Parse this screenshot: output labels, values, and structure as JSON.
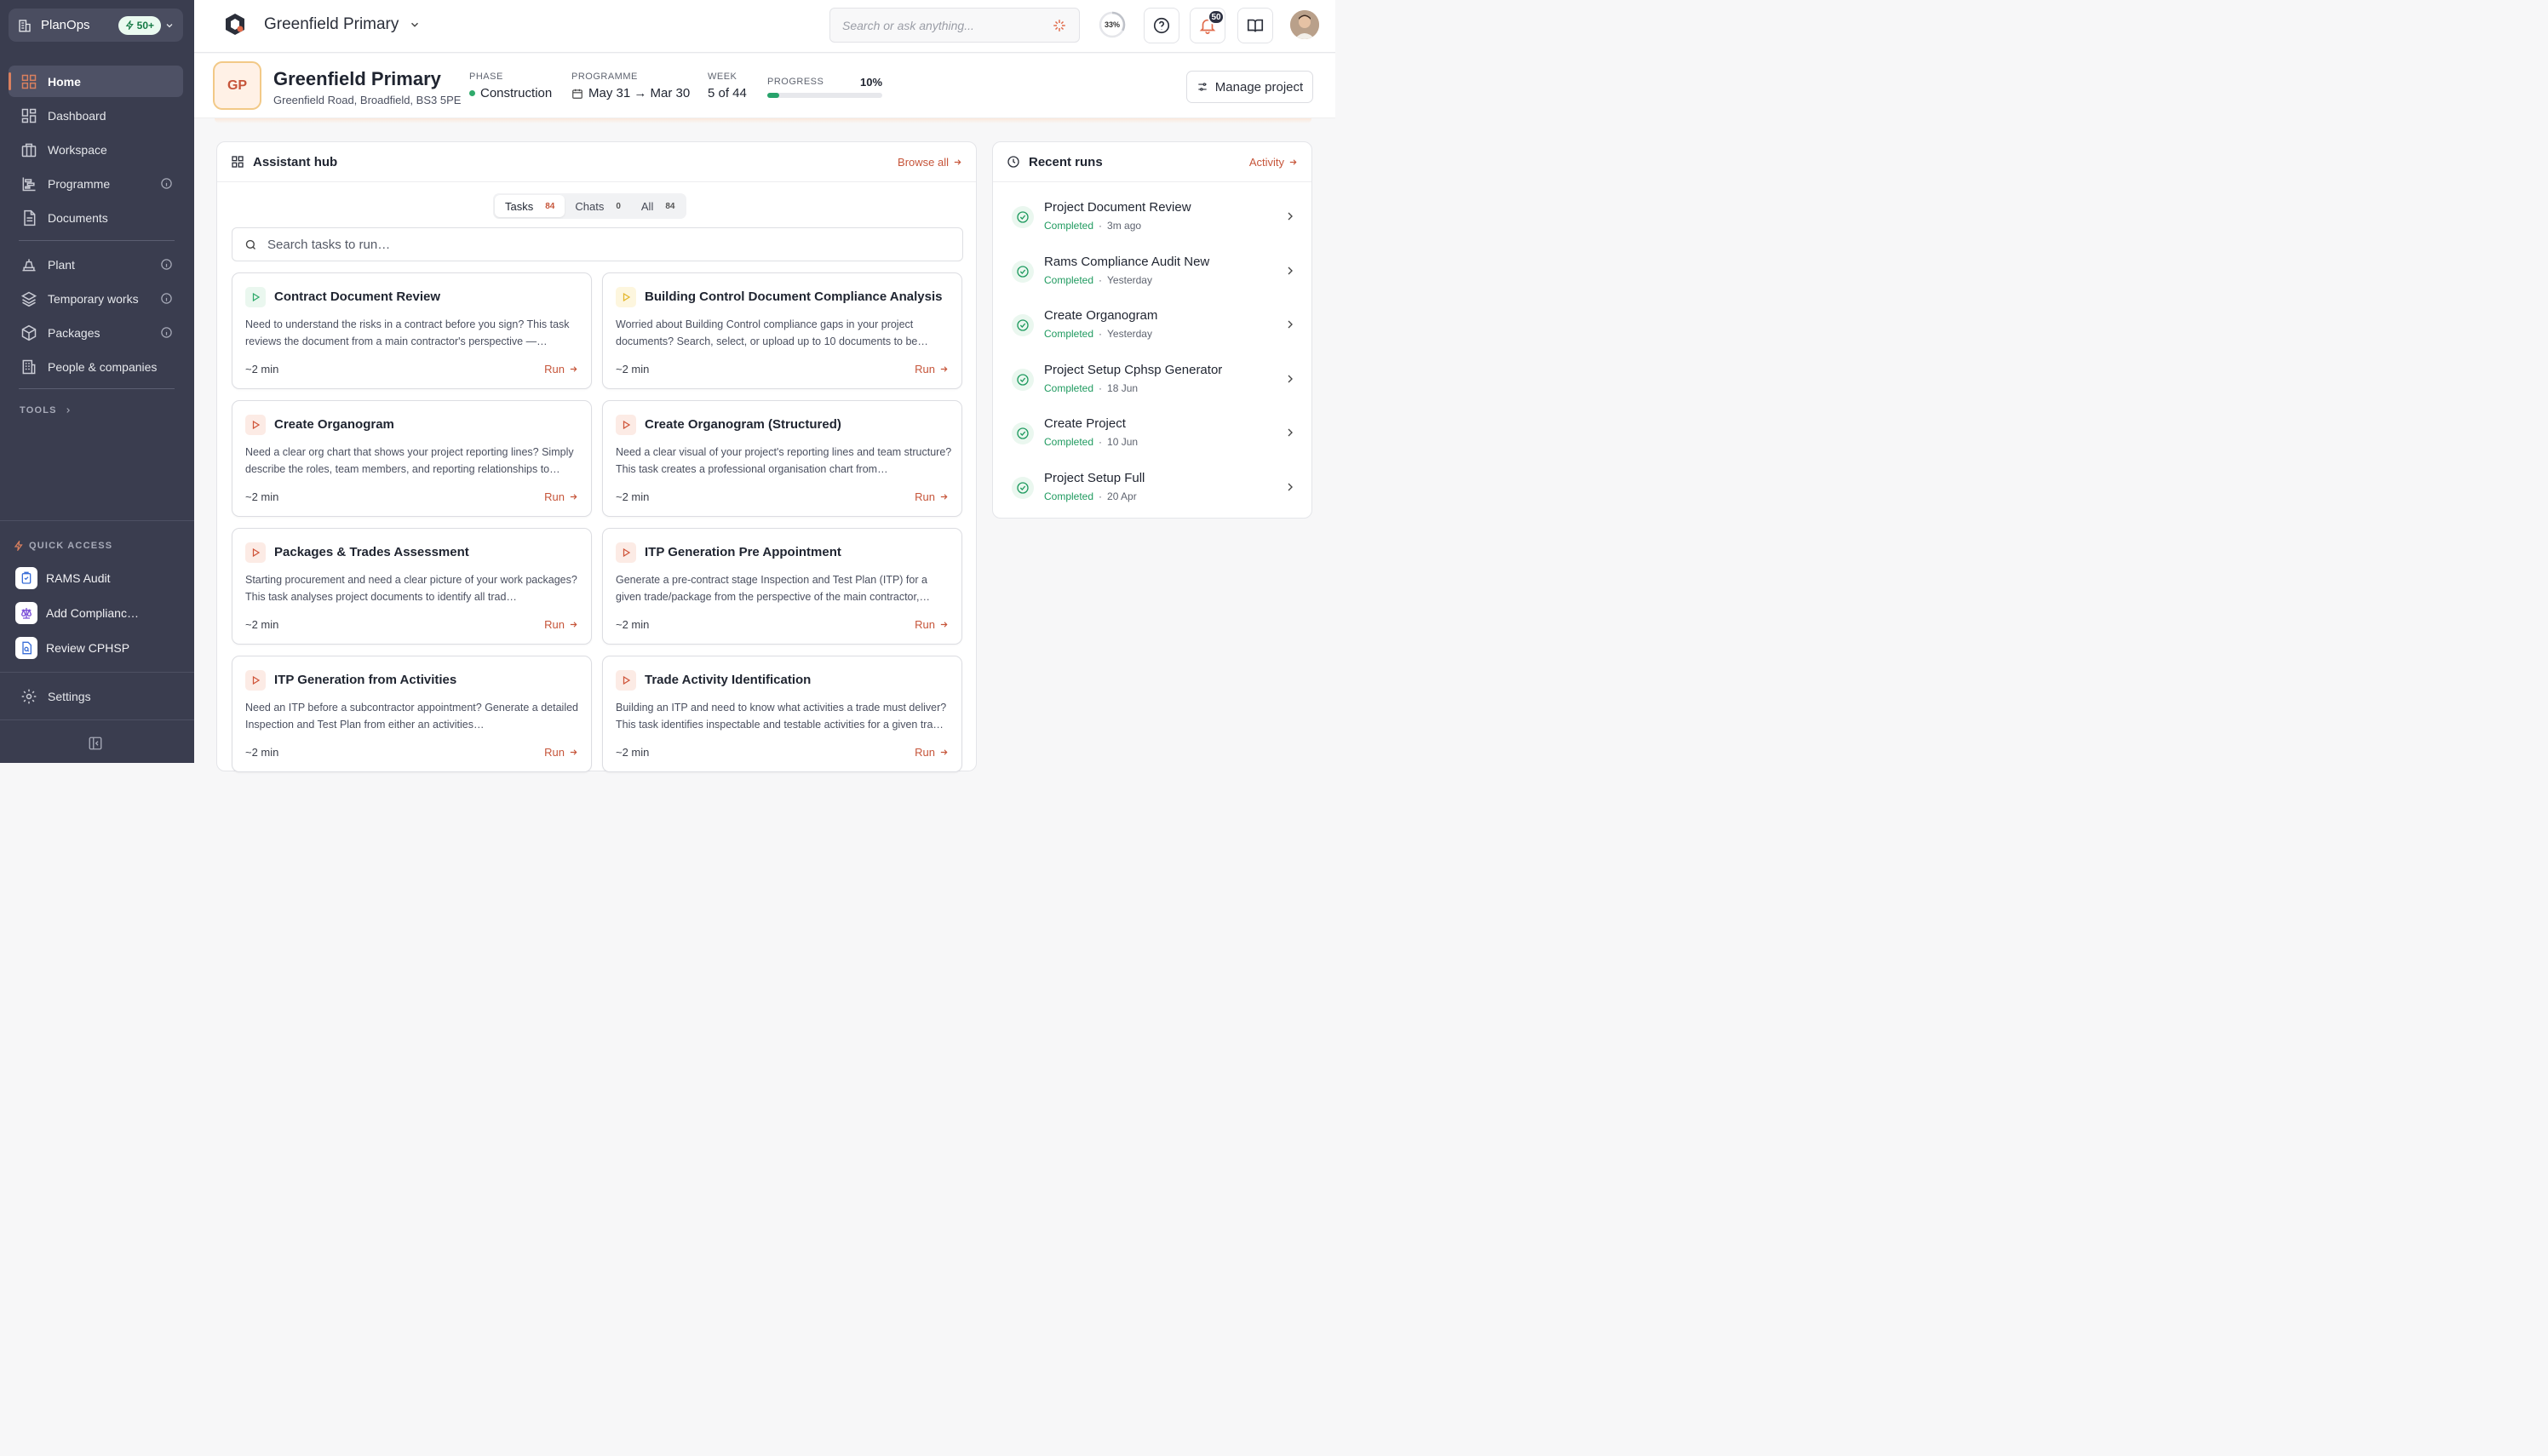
{
  "sidebar": {
    "brand": "PlanOps",
    "credits": "50+",
    "nav": [
      {
        "label": "Home",
        "icon": "home-grid-icon",
        "active": true
      },
      {
        "label": "Dashboard",
        "icon": "dashboard-icon"
      },
      {
        "label": "Workspace",
        "icon": "workspace-icon"
      },
      {
        "label": "Programme",
        "icon": "programme-icon",
        "info": true
      },
      {
        "label": "Documents",
        "icon": "document-icon"
      },
      {
        "label": "Plant",
        "icon": "plant-icon",
        "info": true
      },
      {
        "label": "Temporary works",
        "icon": "layers-icon",
        "info": true
      },
      {
        "label": "Packages",
        "icon": "package-icon",
        "info": true
      },
      {
        "label": "People & companies",
        "icon": "building-icon"
      }
    ],
    "tools_label": "TOOLS",
    "quick_access_label": "QUICK ACCESS",
    "quick_access": [
      {
        "label": "RAMS Audit"
      },
      {
        "label": "Add Complianc…"
      },
      {
        "label": "Review CPHSP"
      }
    ],
    "settings_label": "Settings"
  },
  "topbar": {
    "project_name": "Greenfield Primary",
    "search_placeholder": "Search or ask anything...",
    "usage_percent": "33%",
    "notifications_count": "50"
  },
  "project": {
    "initials": "GP",
    "title": "Greenfield Primary",
    "address": "Greenfield Road, Broadfield, BS3 5PE",
    "phase_label": "PHASE",
    "phase_value": "Construction",
    "programme_label": "PROGRAMME",
    "programme_value": "May 31 → Mar 30",
    "week_label": "WEEK",
    "week_value": "5 of 44",
    "progress_label": "PROGRESS",
    "progress_value": "10%",
    "progress_fraction": 0.1,
    "manage_label": "Manage project"
  },
  "hub": {
    "title": "Assistant hub",
    "browse_label": "Browse all",
    "tabs": [
      {
        "label": "Tasks",
        "count": "84",
        "active": true
      },
      {
        "label": "Chats",
        "count": "0"
      },
      {
        "label": "All",
        "count": "84"
      }
    ],
    "search_placeholder": "Search tasks to run…",
    "run_label": "Run",
    "tasks": [
      {
        "title": "Contract Document Review",
        "desc": "Need to understand the risks in a contract before you sign? This task reviews the document from a main contractor's perspective —…",
        "time": "~2 min",
        "icon_color": "#2faa6b",
        "icon_bg": "#eaf7ef"
      },
      {
        "title": "Building Control Document Compliance Analysis",
        "desc": "Worried about Building Control compliance gaps in your project documents? Search, select, or upload up to 10 documents to be…",
        "time": "~2 min",
        "icon_color": "#e3b62b",
        "icon_bg": "#fdf6de"
      },
      {
        "title": "Create Organogram",
        "desc": "Need a clear org chart that shows your project reporting lines? Simply describe the roles, team members, and reporting relationships to…",
        "time": "~2 min",
        "icon_color": "#d0553a",
        "icon_bg": "#fcebe5"
      },
      {
        "title": "Create Organogram (Structured)",
        "desc": "Need a clear visual of your project's reporting lines and team structure? This task creates a professional organisation chart from…",
        "time": "~2 min",
        "icon_color": "#d0553a",
        "icon_bg": "#fcebe5"
      },
      {
        "title": "Packages & Trades Assessment",
        "desc": "Starting procurement and need a clear picture of your work packages? This task analyses project documents to identify all trad…",
        "time": "~2 min",
        "icon_color": "#d0553a",
        "icon_bg": "#fcebe5"
      },
      {
        "title": "ITP Generation Pre Appointment",
        "desc": "Generate a pre-contract stage Inspection and Test Plan (ITP) for a given trade/package from the perspective of the main contractor,…",
        "time": "~2 min",
        "icon_color": "#d0553a",
        "icon_bg": "#fcebe5"
      },
      {
        "title": "ITP Generation from Activities",
        "desc": "Need an ITP before a subcontractor appointment? Generate a detailed Inspection and Test Plan from either an activities…",
        "time": "~2 min",
        "icon_color": "#d0553a",
        "icon_bg": "#fcebe5"
      },
      {
        "title": "Trade Activity Identification",
        "desc": "Building an ITP and need to know what activities a trade must deliver? This task identifies inspectable and testable activities for a given tra…",
        "time": "~2 min",
        "icon_color": "#d0553a",
        "icon_bg": "#fcebe5"
      }
    ]
  },
  "recent": {
    "title": "Recent runs",
    "activity_label": "Activity",
    "runs": [
      {
        "name": "Project Document Review",
        "status": "Completed",
        "when": "3m ago"
      },
      {
        "name": "Rams Compliance Audit New",
        "status": "Completed",
        "when": "Yesterday"
      },
      {
        "name": "Create Organogram",
        "status": "Completed",
        "when": "Yesterday"
      },
      {
        "name": "Project Setup Cphsp Generator",
        "status": "Completed",
        "when": "18 Jun"
      },
      {
        "name": "Create Project",
        "status": "Completed",
        "when": "10 Jun"
      },
      {
        "name": "Project Setup Full",
        "status": "Completed",
        "when": "20 Apr"
      }
    ]
  },
  "colors": {
    "accent": "#c6553a",
    "success": "#1f9a5f",
    "sidebar": "#3a3d4f"
  }
}
